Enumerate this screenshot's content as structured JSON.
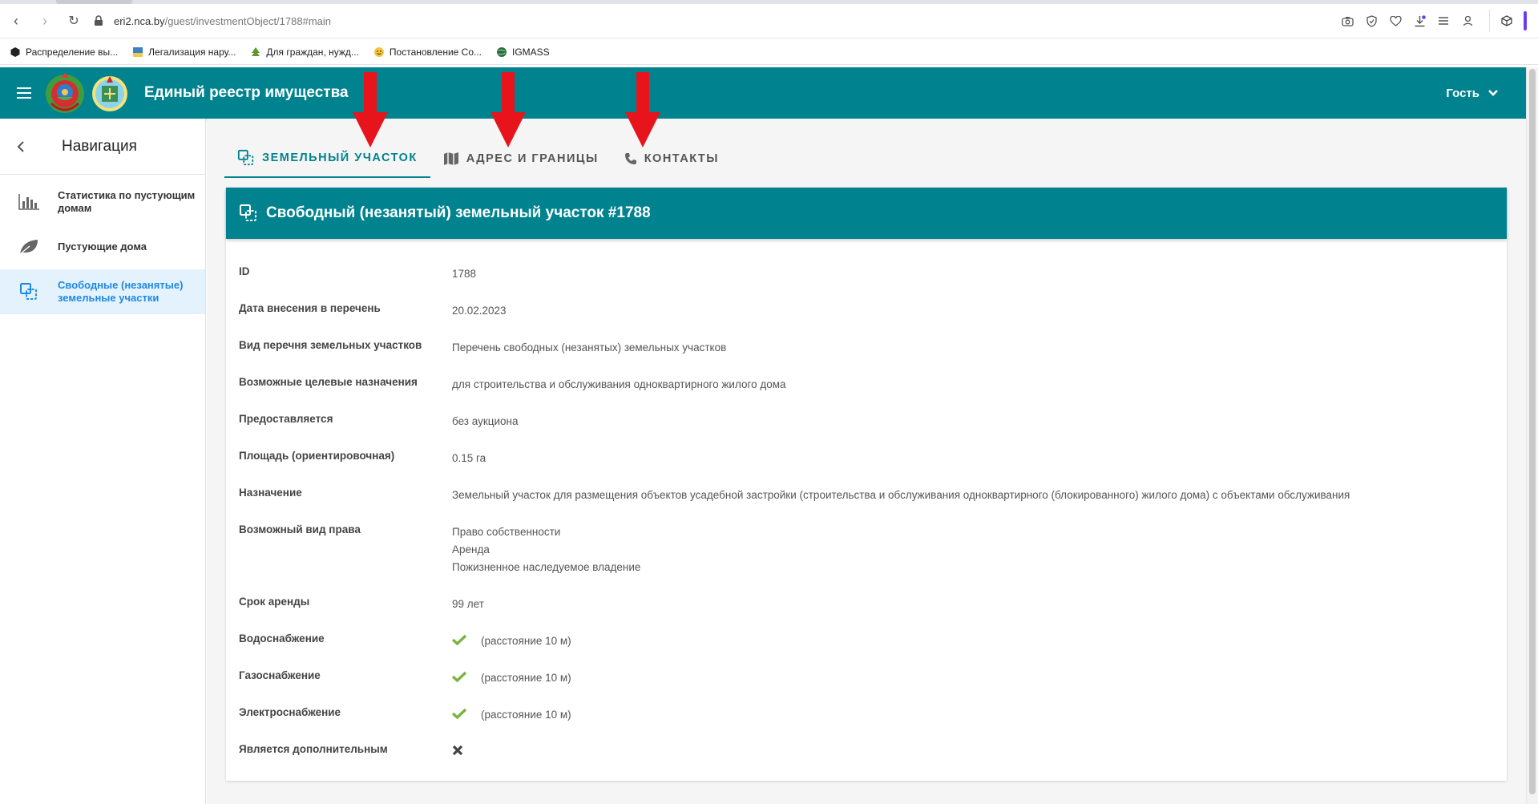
{
  "browser": {
    "url_host": "eri2.nca.by",
    "url_path": "/guest/investmentObject/1788#main",
    "bookmarks": [
      {
        "label": "Распределение вы...",
        "color": "#222222"
      },
      {
        "label": "Легализация нару...",
        "color": "#3b82c4"
      },
      {
        "label": "Для граждан, нужд...",
        "color": "#5a9a2f"
      },
      {
        "label": "Постановление Со...",
        "color": "#e0a51b"
      },
      {
        "label": "IGMASS",
        "color": "#2b6f3e"
      }
    ]
  },
  "header": {
    "title": "Единый реестр имущества",
    "user": "Гость",
    "color": "#00838f"
  },
  "sidebar": {
    "title": "Навигация",
    "items": [
      {
        "label": "Статистика по пустующим домам",
        "icon": "bar-chart-icon",
        "active": false
      },
      {
        "label": "Пустующие дома",
        "icon": "leaf-icon",
        "active": false
      },
      {
        "label": "Свободные (незанятые) земельные участки",
        "icon": "land-plot-icon",
        "active": true
      }
    ]
  },
  "tabs": [
    {
      "label": "Земельный участок",
      "icon": "land-plot-icon",
      "active": true
    },
    {
      "label": "Адрес и границы",
      "icon": "map-icon",
      "active": false
    },
    {
      "label": "Контакты",
      "icon": "phone-icon",
      "active": false
    }
  ],
  "card": {
    "title": "Свободный (незанятый) земельный участок #1788",
    "fields": [
      {
        "key": "ID",
        "value": "1788"
      },
      {
        "key": "Дата внесения в перечень",
        "value": "20.02.2023"
      },
      {
        "key": "Вид перечня земельных участков",
        "value": "Перечень свободных (незанятых) земельных участков"
      },
      {
        "key": "Возможные целевые назначения",
        "value": "для строительства и обслуживания одноквартирного жилого дома"
      },
      {
        "key": "Предоставляется",
        "value": "без аукциона"
      },
      {
        "key": "Площадь (ориентировочная)",
        "value": "0.15 га"
      },
      {
        "key": "Назначение",
        "value": "Земельный участок для размещения объектов усадебной застройки (строительства и обслуживания одноквартирного (блокированного) жилого дома) с объектами обслуживания"
      },
      {
        "key": "Возможный вид права",
        "lines": [
          "Право собственности",
          "Аренда",
          "Пожизненное наследуемое владение"
        ]
      },
      {
        "key": "Срок аренды",
        "value": "99 лет"
      },
      {
        "key": "Водоснабжение",
        "flag": true,
        "note": "(расстояние 10 м)"
      },
      {
        "key": "Газоснабжение",
        "flag": true,
        "note": "(расстояние 10 м)"
      },
      {
        "key": "Электроснабжение",
        "flag": true,
        "note": "(расстояние 10 м)"
      },
      {
        "key": "Является дополнительным",
        "flag": false,
        "note": ""
      }
    ]
  },
  "colors": {
    "accent": "#00838f",
    "check": "#7cb342",
    "cross": "#444444",
    "arrow": "#e8141b",
    "active_nav": "#1e88e5"
  }
}
